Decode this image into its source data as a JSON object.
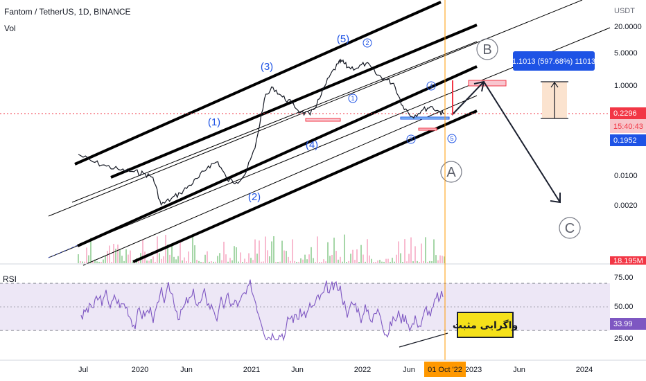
{
  "header": {
    "title": "Fantom / TetherUS, 1D, BINANCE",
    "vol": "Vol",
    "currency": "USDT"
  },
  "rsi": {
    "label": "RSI",
    "value": "33.99"
  },
  "price_tags": {
    "last": "0.2296",
    "countdown": "15:40:43",
    "level": "0.1952",
    "volume": "18.195M"
  },
  "measure": {
    "label": "1.1013 (597.68%) 11013"
  },
  "annotation": {
    "persian": "واگرایی مثبت"
  },
  "crosshair": {
    "date": "01 Oct '22"
  },
  "colors": {
    "background": "#ffffff",
    "price_line": "#131722",
    "rsi_line": "#7e57c2",
    "rsi_band": "#ede7f6",
    "measure": "#1e53e5",
    "last_price": "#f23645",
    "vertical": "#ff9800",
    "level_tag": "#1e53e5"
  },
  "chart_data": {
    "type": "line",
    "price": {
      "x": [
        "2019-06-15",
        "2019-08-01",
        "2019-09-15",
        "2019-11-01",
        "2019-12-15",
        "2020-01-15",
        "2020-02-15",
        "2020-03-13",
        "2020-04-15",
        "2020-05-15",
        "2020-06-15",
        "2020-07-15",
        "2020-08-15",
        "2020-09-15",
        "2020-10-15",
        "2020-11-15",
        "2020-12-15",
        "2021-01-15",
        "2021-02-15",
        "2021-03-15",
        "2021-04-15",
        "2021-05-15",
        "2021-06-15",
        "2021-07-15",
        "2021-08-15",
        "2021-09-15",
        "2021-10-15",
        "2021-10-28",
        "2021-11-15",
        "2021-12-15",
        "2022-01-15",
        "2022-02-15",
        "2022-03-15",
        "2022-04-15",
        "2022-05-15",
        "2022-06-15",
        "2022-07-15",
        "2022-08-15",
        "2022-09-15",
        "2022-09-28"
      ],
      "y": [
        0.029,
        0.02,
        0.016,
        0.013,
        0.012,
        0.011,
        0.009,
        0.0022,
        0.003,
        0.004,
        0.006,
        0.009,
        0.016,
        0.02,
        0.008,
        0.007,
        0.011,
        0.04,
        0.5,
        0.9,
        0.55,
        0.4,
        0.25,
        0.22,
        0.5,
        1.5,
        3.0,
        3.4,
        2.5,
        2.4,
        3.1,
        1.8,
        1.4,
        1.1,
        0.35,
        0.2,
        0.27,
        0.34,
        0.25,
        0.2296
      ]
    },
    "price_labels": [
      "(1)",
      "(2)",
      "(3)",
      "(4)",
      "(5)",
      "A",
      "B",
      "C"
    ],
    "circled_labels": [
      "1",
      "2",
      "3",
      "4",
      "5"
    ],
    "y_ticks": [
      "20.0000",
      "5.0000",
      "1.0000",
      "0.2296",
      "0.0100",
      "0.0020"
    ],
    "x_ticks": [
      "Jul",
      "2020",
      "Jun",
      "2021",
      "Jun",
      "2022",
      "Jun",
      "2023",
      "Jun",
      "2024"
    ],
    "rsi": {
      "ticks": [
        "75.00",
        "50.00",
        "25.00"
      ],
      "ylim": [
        20,
        80
      ],
      "levels": [
        70,
        50,
        30
      ]
    }
  }
}
